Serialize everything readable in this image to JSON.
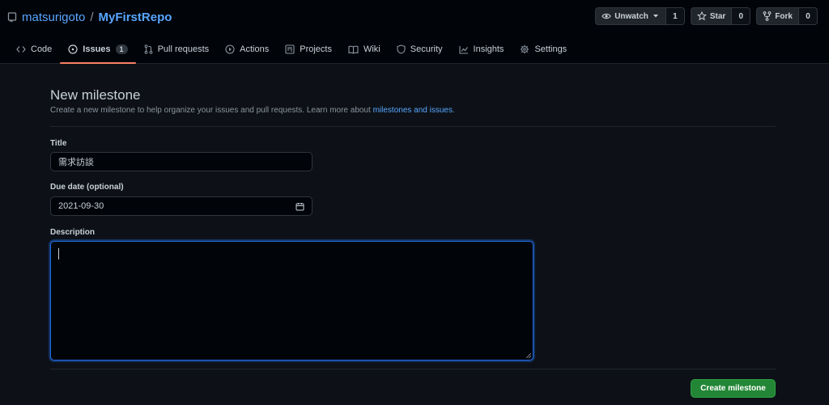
{
  "repo": {
    "owner": "matsurigoto",
    "separator": "/",
    "name": "MyFirstRepo"
  },
  "actions": {
    "watch": {
      "label": "Unwatch",
      "count": "1"
    },
    "star": {
      "label": "Star",
      "count": "0"
    },
    "fork": {
      "label": "Fork",
      "count": "0"
    }
  },
  "tabs": [
    {
      "label": "Code",
      "icon": "code-icon"
    },
    {
      "label": "Issues",
      "icon": "issue-icon",
      "counter": "1",
      "selected": true
    },
    {
      "label": "Pull requests",
      "icon": "pull-request-icon"
    },
    {
      "label": "Actions",
      "icon": "play-icon"
    },
    {
      "label": "Projects",
      "icon": "project-icon"
    },
    {
      "label": "Wiki",
      "icon": "book-icon"
    },
    {
      "label": "Security",
      "icon": "shield-icon"
    },
    {
      "label": "Insights",
      "icon": "graph-icon"
    },
    {
      "label": "Settings",
      "icon": "gear-icon"
    }
  ],
  "form": {
    "heading": "New milestone",
    "subtitle": "Create a new milestone to help organize your issues and pull requests. Learn more about ",
    "subtitle_link": "milestones and issues",
    "subtitle_end": ".",
    "title_label": "Title",
    "title_value": "需求訪談",
    "due_label": "Due date (optional)",
    "due_value": "2021-09-30",
    "description_label": "Description",
    "description_value": "",
    "submit_label": "Create milestone"
  },
  "colors": {
    "background": "#0d1117",
    "header_background": "#010409",
    "link": "#58a6ff",
    "accent_underline": "#f78166",
    "primary_button": "#238636",
    "focus_border": "#1f6feb"
  }
}
